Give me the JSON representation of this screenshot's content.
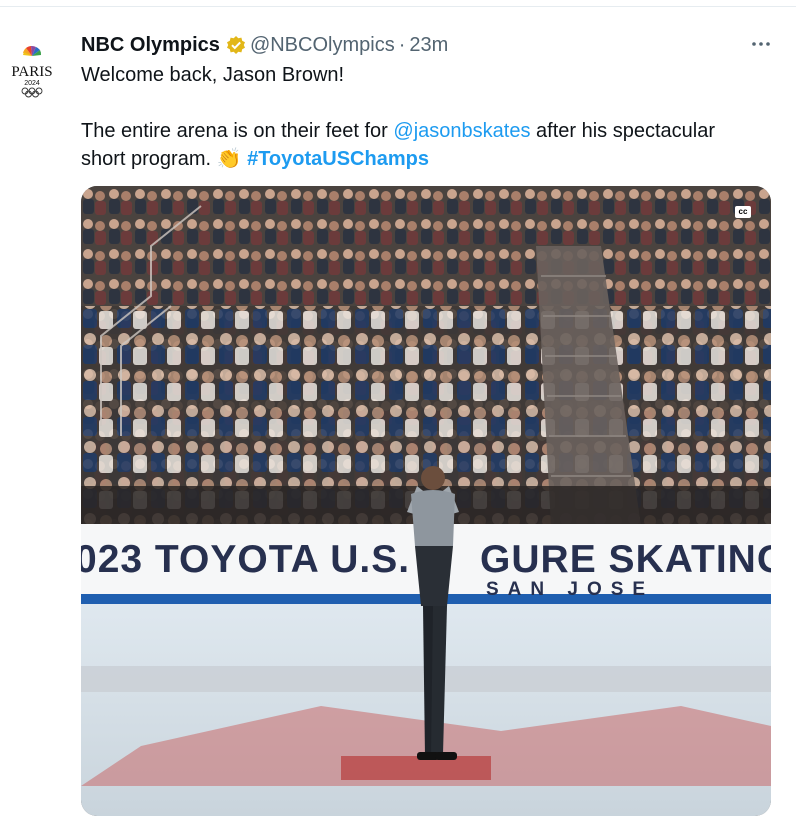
{
  "tweet": {
    "author_name": "NBC Olympics",
    "handle": "@NBCOlympics",
    "separator": "·",
    "timestamp": "23m",
    "avatar": {
      "logo_text": "PARIS",
      "year": "2024"
    },
    "line1": "Welcome back, Jason Brown!",
    "line2_prefix": "The entire arena is on their feet for ",
    "mention": "@jasonbskates",
    "line2_suffix": " after his spectacular",
    "line3_prefix": "short program. ",
    "emoji": "👏",
    "hashtag": "#ToyotaUSChamps"
  },
  "media": {
    "cc_label": "cc",
    "banner_left": "023 TOYOTA U.S.",
    "banner_right": "GURE SKATING",
    "banner_city": "SAN JOSE"
  },
  "colors": {
    "link": "#1d9bf0",
    "secondary_text": "#536471",
    "verified_badge": "#e2b719",
    "banner_text": "#27304f"
  },
  "icons": {
    "verified": "verified-badge-icon",
    "more": "more-options-icon",
    "avatar": "nbc-peacock-logo"
  }
}
